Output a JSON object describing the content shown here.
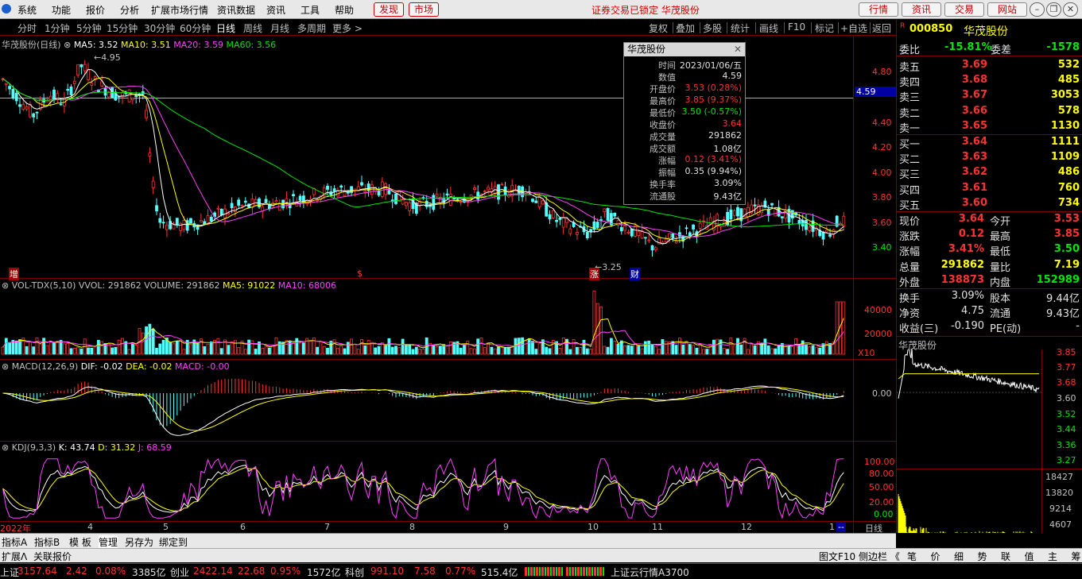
{
  "menu": {
    "items": [
      "系统",
      "功能",
      "报价",
      "分析",
      "扩展市场行情",
      "资讯数据",
      "资讯",
      "工具",
      "帮助"
    ],
    "discover": "发现",
    "market": "市场",
    "notice": "证券交易已锁定 华茂股份",
    "buttons": [
      "行情",
      "资讯",
      "交易",
      "网站"
    ]
  },
  "toolbar": {
    "periods": [
      "分时",
      "1分钟",
      "5分钟",
      "15分钟",
      "30分钟",
      "60分钟",
      "日线",
      "周线",
      "月线",
      "多周期",
      "更多"
    ],
    "active_period": "日线",
    "right": [
      "复权",
      "叠加",
      "多股",
      "统计",
      "画线",
      "F10",
      "标记",
      "+自选",
      "返回"
    ]
  },
  "main_chart": {
    "title": "华茂股份(日线)",
    "ma5": "MA5: 3.52",
    "ma10": "MA10: 3.51",
    "ma20": "MA20: 3.59",
    "ma60": "MA60: 3.56",
    "price_ticks": [
      "4.80",
      "4.59",
      "4.40",
      "4.20",
      "4.00",
      "3.80",
      "3.60",
      "3.40"
    ],
    "crosshair_value": "4.59",
    "high_mark": "4.95",
    "low_mark": "3.25",
    "markers": [
      "增",
      "$",
      "涨",
      "财"
    ]
  },
  "volume_chart": {
    "label": "VOL-TDX(5,10)",
    "vvol": "VVOL: 291862",
    "volume": "VOLUME: 291862",
    "ma5": "MA5: 91022",
    "ma10": "MA10: 68006",
    "ticks": [
      "40000",
      "20000"
    ],
    "scale": "X10"
  },
  "macd_chart": {
    "label": "MACD(12,26,9)",
    "dif": "DIF: -0.02",
    "dea": "DEA: -0.02",
    "macd": "MACD: -0.00",
    "ticks": [
      "0.00"
    ]
  },
  "kdj_chart": {
    "label": "KDJ(9,3,3)",
    "k": "K: 43.74",
    "d": "D: 31.32",
    "j": "J: 68.59",
    "ticks": [
      "100.00",
      "80.00",
      "50.00",
      "20.00",
      "0.00"
    ]
  },
  "x_axis": {
    "labels": [
      "2022年",
      "4",
      "5",
      "6",
      "7",
      "8",
      "9",
      "10",
      "11",
      "12",
      "1"
    ],
    "period": "日线"
  },
  "tooltip": {
    "title": "华茂股份",
    "rows": [
      {
        "k": "时间",
        "v": "2023/01/06/五",
        "c": "white"
      },
      {
        "k": "数值",
        "v": "4.59",
        "c": "white"
      },
      {
        "k": "开盘价",
        "v": "3.53 (0.28%)",
        "c": "red"
      },
      {
        "k": "最高价",
        "v": "3.85 (9.37%)",
        "c": "red"
      },
      {
        "k": "最低价",
        "v": "3.50 (-0.57%)",
        "c": "green"
      },
      {
        "k": "收盘价",
        "v": "3.64",
        "c": "red"
      },
      {
        "k": "成交量",
        "v": "291862",
        "c": "white"
      },
      {
        "k": "成交额",
        "v": "1.08亿",
        "c": "white"
      },
      {
        "k": "涨幅",
        "v": "0.12 (3.41%)",
        "c": "red"
      },
      {
        "k": "振幅",
        "v": "0.35 (9.94%)",
        "c": "white"
      },
      {
        "k": "换手率",
        "v": "3.09%",
        "c": "white"
      },
      {
        "k": "流通股",
        "v": "9.43亿",
        "c": "white"
      }
    ]
  },
  "quote": {
    "code": "000850",
    "name": "华茂股份",
    "r_badge": "R",
    "weibi_label": "委比",
    "weibi": "-15.81%",
    "weicha_label": "委差",
    "weicha": "-1578",
    "asks": [
      {
        "label": "卖五",
        "price": "3.69",
        "vol": "532"
      },
      {
        "label": "卖四",
        "price": "3.68",
        "vol": "485"
      },
      {
        "label": "卖三",
        "price": "3.67",
        "vol": "3053"
      },
      {
        "label": "卖二",
        "price": "3.66",
        "vol": "578"
      },
      {
        "label": "卖一",
        "price": "3.65",
        "vol": "1130"
      }
    ],
    "bids": [
      {
        "label": "买一",
        "price": "3.64",
        "vol": "1111"
      },
      {
        "label": "买二",
        "price": "3.63",
        "vol": "1109"
      },
      {
        "label": "买三",
        "price": "3.62",
        "vol": "486"
      },
      {
        "label": "买四",
        "price": "3.61",
        "vol": "760"
      },
      {
        "label": "买五",
        "price": "3.60",
        "vol": "734"
      }
    ],
    "stats": [
      {
        "l1": "现价",
        "v1": "3.64",
        "c1": "red",
        "l2": "今开",
        "v2": "3.53",
        "c2": "red"
      },
      {
        "l1": "涨跌",
        "v1": "0.12",
        "c1": "red",
        "l2": "最高",
        "v2": "3.85",
        "c2": "red"
      },
      {
        "l1": "涨幅",
        "v1": "3.41%",
        "c1": "red",
        "l2": "最低",
        "v2": "3.50",
        "c2": "green"
      },
      {
        "l1": "总量",
        "v1": "291862",
        "c1": "yellow",
        "l2": "量比",
        "v2": "7.19",
        "c2": "yellow"
      },
      {
        "l1": "外盘",
        "v1": "138873",
        "c1": "red",
        "l2": "内盘",
        "v2": "152989",
        "c2": "green"
      }
    ],
    "stats2": [
      {
        "l1": "换手",
        "v1": "3.09%",
        "l2": "股本",
        "v2": "9.44亿"
      },
      {
        "l1": "净资",
        "v1": "4.75",
        "l2": "流通",
        "v2": "9.43亿"
      },
      {
        "l1": "收益(三)",
        "v1": "-0.190",
        "l2": "PE(动)",
        "v2": "-"
      }
    ]
  },
  "mini_chart": {
    "title": "华茂股份",
    "price_ticks": [
      "3.85",
      "3.77",
      "3.68",
      "3.60",
      "3.52",
      "3.44",
      "3.36",
      "3.27"
    ],
    "vol_ticks": [
      "18427",
      "13820",
      "9214",
      "4607"
    ]
  },
  "bottom_tabs": [
    "指标A",
    "指标B",
    "模 板",
    "管理",
    "另存为",
    "绑定到"
  ],
  "ext_tabs": [
    "扩展Λ",
    "关联报价"
  ],
  "side_controls": {
    "f10": "图文F10",
    "sidebar": "侧边栏 《"
  },
  "right_tabs": [
    "笔",
    "价",
    "细",
    "势",
    "联",
    "值",
    "主",
    "筹"
  ],
  "status": {
    "sh_label": "上证",
    "sh_val": "3157.64",
    "sh_chg": "2.42",
    "sh_pct": "0.08%",
    "sh_amt": "3385亿",
    "cy_label": "创业",
    "cy_val": "2422.14",
    "cy_chg": "22.68",
    "cy_pct": "0.95%",
    "cy_amt": "1572亿",
    "kc_label": "科创",
    "kc_val": "991.10",
    "kc_chg": "7.58",
    "kc_pct": "0.77%",
    "kc_amt": "515.4亿",
    "cloud": "上证云行情A3700"
  },
  "colors": {
    "up": "#ff3232",
    "down": "#54ffff",
    "ma5": "#ffffff",
    "ma10": "#ffff00",
    "ma20": "#ff40ff",
    "ma60": "#00e600"
  }
}
